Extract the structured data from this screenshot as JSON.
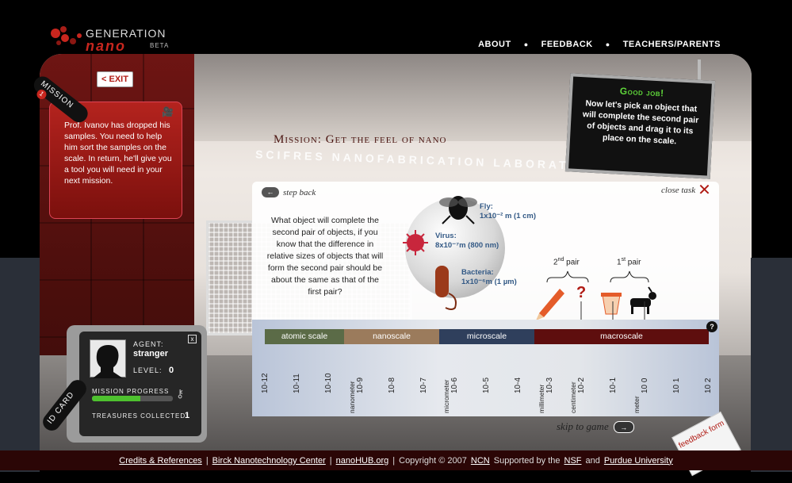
{
  "header": {
    "logo_line1": "GENERATION",
    "logo_line2": "nano",
    "logo_beta": "BETA",
    "nav": [
      "ABOUT",
      "FEEDBACK",
      "TEACHERS/PARENTS"
    ]
  },
  "exit_label": "< EXIT",
  "mission": {
    "ribbon": "MISSION",
    "number": "1",
    "text": "Prof. Ivanov has dropped his samples. You need to help him sort the samples on the scale. In return, he'll give you a tool you will need in your next mission."
  },
  "scene": {
    "mission_title": "Mission: Get the feel of nano",
    "lab_sign": "SCIFRES NANOFABRICATION LABORATORY"
  },
  "board": {
    "title": "Good job!",
    "text": "Now let's pick an object that will complete the second pair of objects and drag it to its place on the scale."
  },
  "task": {
    "step_back": "step back",
    "close_task": "close task",
    "question": "What object will complete the second pair of objects, if you know that the difference in relative sizes of objects that will form the second pair should be about the same as that of the first pair?",
    "objects": [
      {
        "name": "Fly:",
        "size": "1x10⁻² m (1 cm)"
      },
      {
        "name": "Virus:",
        "size": "8x10⁻⁷m (800 nm)"
      },
      {
        "name": "Bacteria:",
        "size": "1x10⁻⁶m (1 µm)"
      }
    ],
    "pair2_num": "2",
    "pair2_sup": "nd",
    "pair2_text": " pair",
    "pair1_num": "1",
    "pair1_sup": "st",
    "pair1_text": " pair",
    "unknown": "?"
  },
  "scale": {
    "bands": [
      {
        "label": "atomic scale",
        "color": "#5b6b47"
      },
      {
        "label": "nanoscale",
        "color": "#9b7b5c"
      },
      {
        "label": "microscale",
        "color": "#2f3f5c"
      },
      {
        "label": "macroscale",
        "color": "#5e0e0e"
      }
    ],
    "ticks": [
      "10-12",
      "10-11",
      "10-10",
      "10-9",
      "10-8",
      "10-7",
      "10-6",
      "10-5",
      "10-4",
      "10-3",
      "10-2",
      "10-1",
      "10 0",
      "10 1",
      "10 2"
    ],
    "unit_labels": [
      {
        "tick": "10-9",
        "label": "nanometer"
      },
      {
        "tick": "10-6",
        "label": "micrometer"
      },
      {
        "tick": "10-3",
        "label": "millimeter"
      },
      {
        "tick": "10-2",
        "label": "centimeter"
      },
      {
        "tick": "10 0",
        "label": "meter"
      }
    ],
    "help": "?"
  },
  "skip_label": "skip to game",
  "idcard": {
    "ribbon": "ID CARD",
    "agent_label": "AGENT:",
    "agent_name": "stranger",
    "level_label": "LEVEL:",
    "level": "0",
    "progress_label": "MISSION PROGRESS",
    "progress": 0.6,
    "treasures_label": "TREASURES COLLECTED:",
    "treasures": "1",
    "close": "x"
  },
  "feedback_tab": "feedback form",
  "footer": {
    "links": [
      "Credits & References",
      "Birck Nanotechnology Center",
      "nanoHUB.org"
    ],
    "copyright": "Copyright © 2007",
    "ncn": "NCN",
    "supported": "Supported by the",
    "nsf": "NSF",
    "and": "and",
    "purdue": "Purdue University"
  }
}
